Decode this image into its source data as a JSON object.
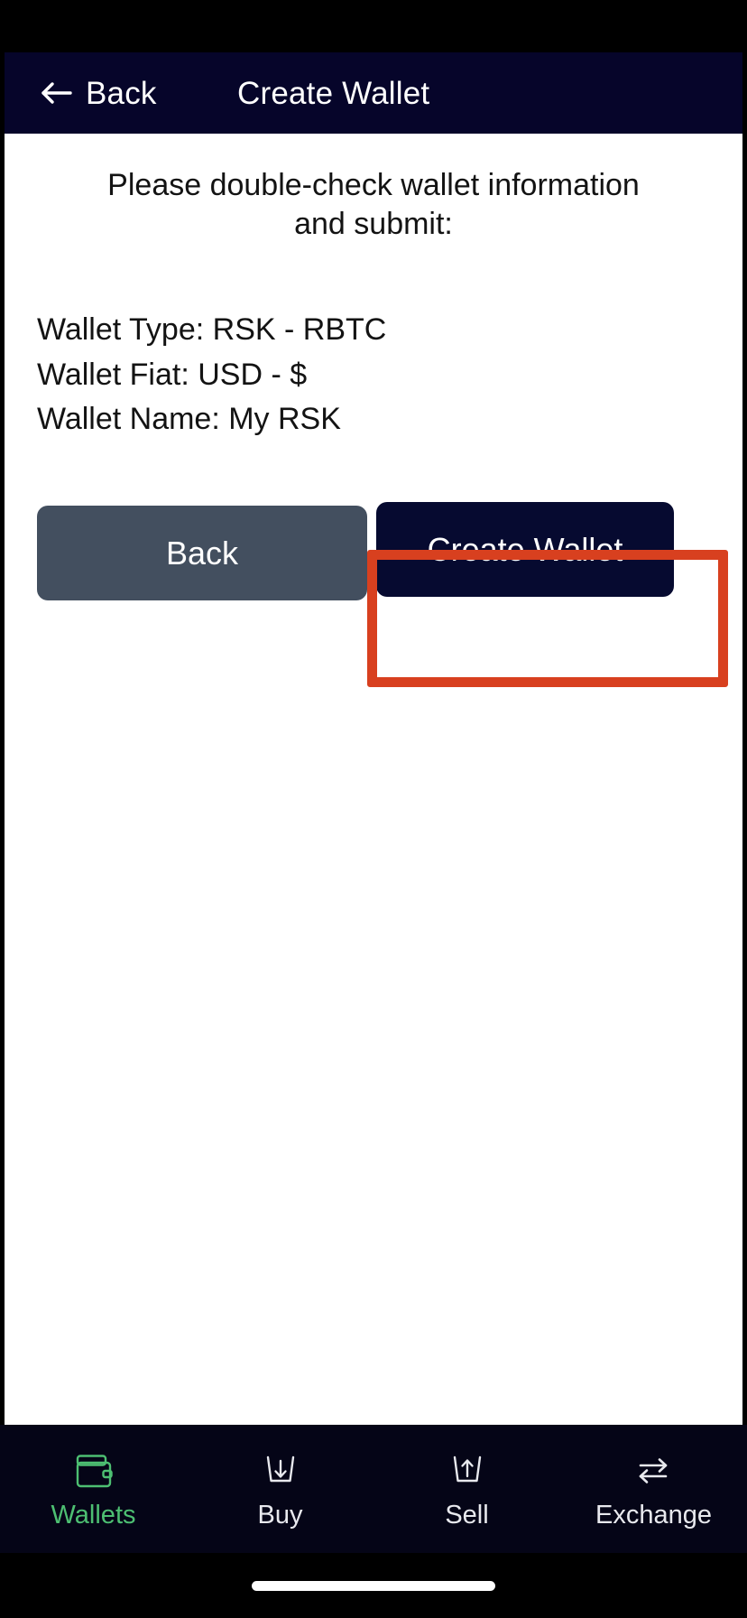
{
  "header": {
    "back_label": "Back",
    "back_icon": "arrow-left-icon",
    "title": "Create Wallet",
    "background_color": "#06052a"
  },
  "main": {
    "prompt": "Please double-check wallet information and submit:",
    "details": [
      "Wallet Type: RSK - RBTC",
      "Wallet Fiat: USD - $",
      "Wallet Name: My RSK"
    ],
    "fields": {
      "wallet_type_label": "Wallet Type:",
      "wallet_type_value": "RSK - RBTC",
      "wallet_fiat_label": "Wallet Fiat:",
      "wallet_fiat_value": "USD - $",
      "wallet_name_label": "Wallet Name:",
      "wallet_name_value": "My RSK"
    },
    "buttons": {
      "back_label": "Back",
      "back_color": "#434f5f",
      "create_label": "Create Wallet",
      "create_color": "#060a30"
    },
    "highlight_color": "#d8401f"
  },
  "tabbar": {
    "background_color": "#050517",
    "active_color": "#4dbf72",
    "inactive_color": "#e8e9ee",
    "items": [
      {
        "label": "Wallets",
        "icon": "wallet-icon",
        "active": true
      },
      {
        "label": "Buy",
        "icon": "tray-arrow-down-icon",
        "active": false
      },
      {
        "label": "Sell",
        "icon": "tray-arrow-up-icon",
        "active": false
      },
      {
        "label": "Exchange",
        "icon": "swap-arrows-icon",
        "active": false
      }
    ]
  }
}
